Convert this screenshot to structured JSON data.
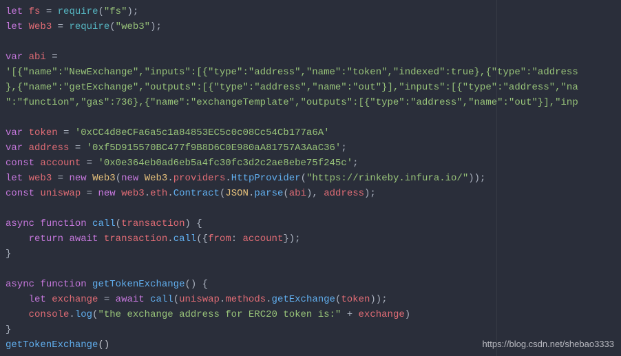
{
  "lines": {
    "l1": {
      "kw_let": "let",
      "fs": "fs",
      "eq": " = ",
      "require": "require",
      "open": "(",
      "str": "\"fs\"",
      "close": ");"
    },
    "l2": {
      "kw_let": "let",
      "web3": "Web3",
      "eq": " = ",
      "require": "require",
      "open": "(",
      "str": "\"web3\"",
      "close": ");"
    },
    "l3": "",
    "l4": {
      "kw_var": "var",
      "abi": "abi",
      "eq": " ="
    },
    "l5": "'[{\"name\":\"NewExchange\",\"inputs\":[{\"type\":\"address\",\"name\":\"token\",\"indexed\":true},{\"type\":\"address",
    "l6": "},{\"name\":\"getExchange\",\"outputs\":[{\"type\":\"address\",\"name\":\"out\"}],\"inputs\":[{\"type\":\"address\",\"na",
    "l7": "\":\"function\",\"gas\":736},{\"name\":\"exchangeTemplate\",\"outputs\":[{\"type\":\"address\",\"name\":\"out\"}],\"inp",
    "l8": "",
    "l9": {
      "kw_var": "var",
      "token": "token",
      "eq": " = ",
      "str": "'0xCC4d8eCFa6a5c1a84853EC5c0c08Cc54Cb177a6A'"
    },
    "l10": {
      "kw_var": "var",
      "address": "address",
      "eq": " = ",
      "str": "'0xf5D915570BC477f9B8D6C0E980aA81757A3AaC36'",
      "semi": ";"
    },
    "l11": {
      "kw_const": "const",
      "account": "account",
      "eq": " = ",
      "str": "'0x0e364eb0ad6eb5a4fc30fc3d2c2ae8ebe75f245c'",
      "semi": ";"
    },
    "l12": {
      "kw_let": "let",
      "web3": "web3",
      "eq": " = ",
      "new": "new",
      "Web3": "Web3",
      "open": "(",
      "new2": "new",
      "Web3b": "Web3",
      "dot": ".",
      "providers": "providers",
      "dot2": ".",
      "HttpProvider": "HttpProvider",
      "open2": "(",
      "url": "\"https://rinkeby.infura.io/\"",
      "close": "));"
    },
    "l13": {
      "kw_const": "const",
      "uniswap": "uniswap",
      "eq": " = ",
      "new": "new",
      "web3": "web3",
      "dot": ".",
      "eth": "eth",
      "dot2": ".",
      "Contract": "Contract",
      "open": "(",
      "JSON": "JSON",
      "dot3": ".",
      "parse": "parse",
      "open2": "(",
      "abi": "abi",
      "close2": ")",
      "comma": ", ",
      "address": "address",
      "close": ");"
    },
    "l14": "",
    "l15": {
      "async": "async",
      "function": "function",
      "call": "call",
      "open": "(",
      "transaction": "transaction",
      "close": ") {"
    },
    "l16": {
      "indent": "    ",
      "return": "return",
      "await": "await",
      "transaction": "transaction",
      "dot": ".",
      "call": "call",
      "open": "({",
      "from": "from",
      "colon": ": ",
      "account": "account",
      "close": "});"
    },
    "l17": "}",
    "l18": "",
    "l19": {
      "async": "async",
      "function": "function",
      "name": "getTokenExchange",
      "open": "() {"
    },
    "l20": {
      "indent": "    ",
      "let": "let",
      "exchange": "exchange",
      "eq": " = ",
      "await": "await",
      "call": "call",
      "open": "(",
      "uniswap": "uniswap",
      "dot": ".",
      "methods": "methods",
      "dot2": ".",
      "getExchange": "getExchange",
      "open2": "(",
      "token": "token",
      "close": "));"
    },
    "l21": {
      "indent": "    ",
      "console": "console",
      "dot": ".",
      "log": "log",
      "open": "(",
      "str": "\"the exchange address for ERC20 token is:\"",
      "plus": " + ",
      "exchange": "exchange",
      "close": ")"
    },
    "l22": "}",
    "l23": {
      "name": "getTokenExchange",
      "open": "(",
      "close": ")"
    }
  },
  "watermark": "https://blog.csdn.net/shebao3333"
}
